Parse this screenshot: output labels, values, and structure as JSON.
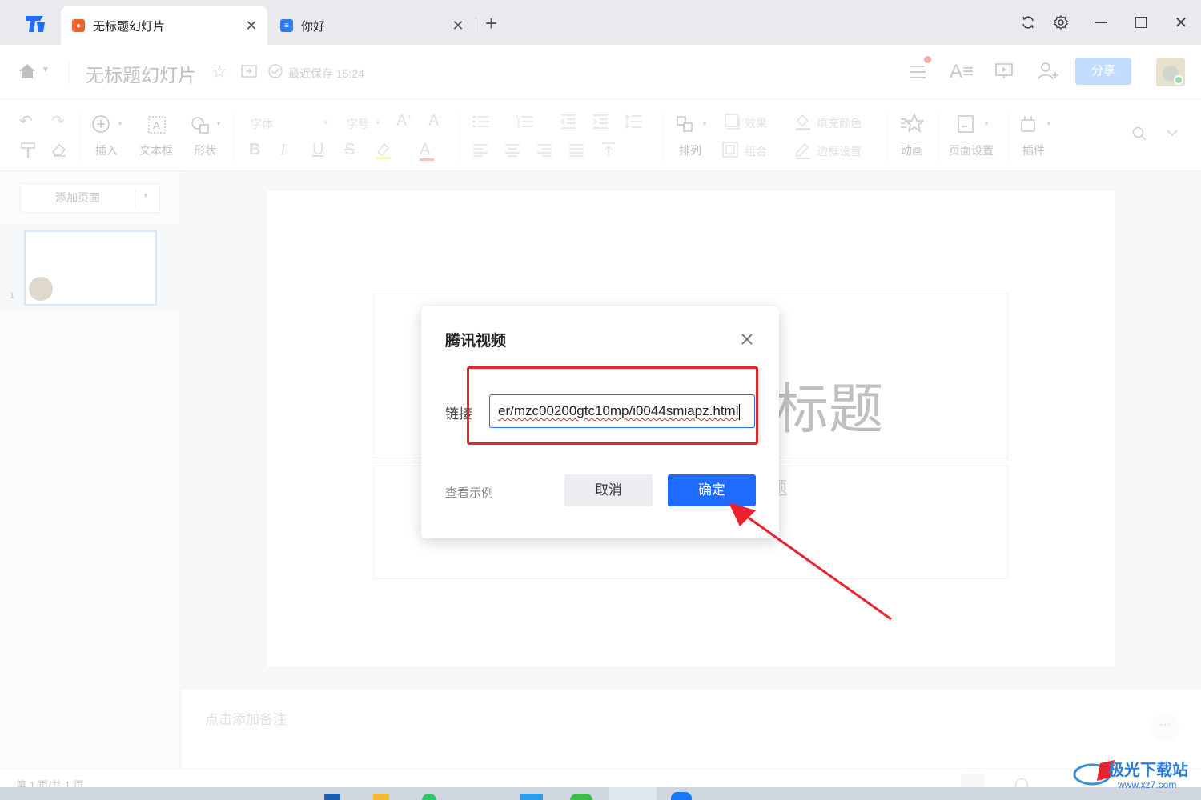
{
  "tabs": [
    {
      "label": "无标题幻灯片",
      "active": true,
      "icon_color": "#f0622a"
    },
    {
      "label": "你好",
      "active": false,
      "icon_color": "#2f7cf6"
    }
  ],
  "header": {
    "doc_title": "无标题幻灯片",
    "save_status": "最近保存 15:24",
    "share_label": "分享"
  },
  "toolbar": {
    "insert": "插入",
    "textbox": "文本框",
    "shape": "形状",
    "font_placeholder": "字体",
    "size_placeholder": "字号",
    "effect": "效果",
    "fill_color": "填充颜色",
    "arrange": "排列",
    "group": "组合",
    "border": "边框设置",
    "animation": "动画",
    "page_setup": "页面设置",
    "plugin": "插件",
    "bold": "B",
    "italic": "I",
    "underline": "U",
    "strike": "S",
    "font_color": "A"
  },
  "sidebar": {
    "add_page": "添加页面",
    "slide_number": "1"
  },
  "slide": {
    "title_partial": "标题",
    "subtitle_partial": "题"
  },
  "notes": {
    "placeholder": "点击添加备注"
  },
  "status": {
    "page_info": "第 1 页/共 1 页"
  },
  "dialog": {
    "title": "腾讯视频",
    "link_label": "链接",
    "link_value": "er/mzc00200gtc10mp/i0044smiapz.html",
    "view_example": "查看示例",
    "cancel": "取消",
    "confirm": "确定"
  },
  "watermark": {
    "text": "极光下载站",
    "url": "www.xz7.com"
  },
  "colors": {
    "accent": "#1f6bff",
    "annotation_red": "#e8232b",
    "share_button": "#8fc0ff"
  }
}
